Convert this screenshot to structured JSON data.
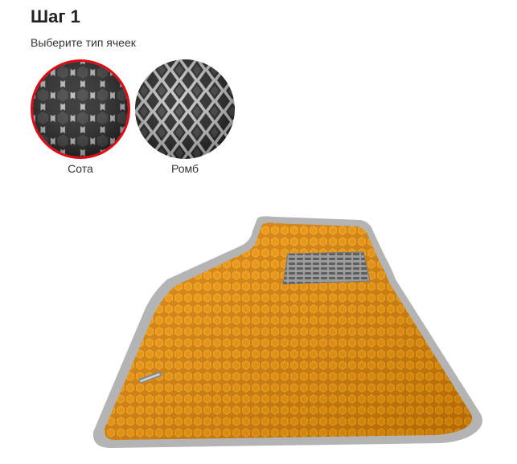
{
  "step": {
    "title": "Шаг 1",
    "subtitle": "Выберите тип ячеек"
  },
  "cell_types": [
    {
      "label": "Сота",
      "selected": true,
      "pattern": "honeycomb-icon"
    },
    {
      "label": "Ромб",
      "selected": false,
      "pattern": "rhombus-icon"
    }
  ],
  "preview": {
    "image": "car-floor-mat",
    "mat_color": "#f29400",
    "border_color": "#b4b4b4",
    "heel_pad": "metal-heel-pad"
  },
  "colors": {
    "accent": "#e30613"
  }
}
